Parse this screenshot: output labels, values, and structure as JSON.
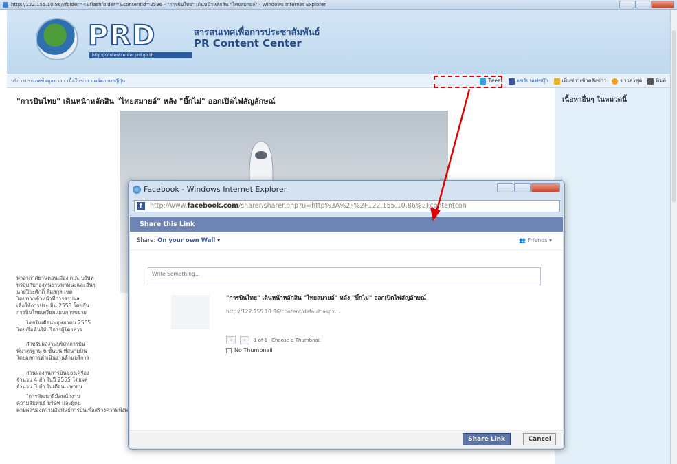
{
  "browser": {
    "title": "http://122.155.10.86/?folder=4&flashfolder=&contentid=2596 - \"การบินไทย\" เดินหน้าหลักสิน \"ไทยสมายล์\" - Windows Internet Explorer"
  },
  "site": {
    "logo_text": "PRD",
    "logo_url": "http://contentcenter.prd.go.th",
    "name_th": "สารสนเทศเพื่อการประชาสัมพันธ์",
    "name_en": "PR Content Center"
  },
  "nav": {
    "breadcrumb": "บริการประเภทข้อมูลข่าว › เนื้อในข่าว › ผลิตภาษาญี่ปุ่น",
    "actions": [
      {
        "label": "Tweet",
        "icon": "twitter-icon",
        "color": "#3aa0e0"
      },
      {
        "label": "แชร์บนเฟซบุ๊ก",
        "icon": "facebook-icon",
        "color": "#3b5998"
      },
      {
        "label": "เพิ่มข่าวเข้าคลังข่าว",
        "icon": "folder-icon",
        "color": "#e3b12c"
      },
      {
        "label": "ข่าวล่าสุด",
        "icon": "star-icon",
        "color": "#f0a020"
      },
      {
        "label": "พิมพ์",
        "icon": "printer-icon",
        "color": "#555555"
      }
    ]
  },
  "article": {
    "title": "\"การบินไทย\" เดินหน้าหลักสิน \"ไทยสมายล์\" หลัง \"บี๊กไม่\" ออกเปิดไฟสัญลักษณ์",
    "paragraphs": [
      [
        "ท่าอากาศยานดอนเมือง ก.ล. บริษัท",
        "พร้อมกับกองทุนยานพาหนะและอื่นๆ",
        "นายปิยะศักดิ์ ลิ่มสกุล เขต",
        "โดยทางเจ้าหน้าที่การสรุปผล",
        "เพื่อให้การประเมิน 2555 โดยกัน",
        "การบินไทยเตรียมแผนการขยาย"
      ],
      [
        "โดยในเดือนพฤษภาคม 2555",
        "โดยเริ่มต้นให้บริการผู้โดยสาร"
      ],
      [
        "สำหรับผลงานบริษัทการบิน",
        "ที่มาตรฐาน 6 ชั้นบน ที่สนามบิน",
        "โดยผลการดำเนินงานด้านบริการ"
      ],
      [
        "ส่วนผลงานการบินของเครื่อง",
        "จำนวน 4 ลำ ในปี 2555 โดยผล",
        "จำนวน 3 ลำ ในเดือนเมษายน"
      ],
      [
        "\"การพัฒนาฝีมือพนักงาน",
        "ความสัมพันธ์ บริษัท และผู้คน",
        "ตามผลของความสัมพันธ์การบินเพื่อสร้างความพึงพอใจต่อผู้โดยสาร"
      ]
    ]
  },
  "sidebar": {
    "title": "เนื้อหาอื่นๆ ในหมวดนี้"
  },
  "facebook_popup": {
    "window_title": "Facebook - Windows Internet Explorer",
    "address_prefix": "http://www.",
    "address_domain": "facebook.com",
    "address_rest": "/sharer/sharer.php?u=http%3A%2F%2F122.155.10.86%2Fcontentcon",
    "bar_label": "Share this Link",
    "share_label": "Share:",
    "share_target": "On your own Wall",
    "audience": "Friends",
    "textarea_placeholder": "Write Something...",
    "link_title": "\"การบินไทย\" เดินหน้าหลักสิน \"ไทยสมายล์\" หลัง \"บี๊กไม่\" ออกเปิดไฟสัญลักษณ์",
    "link_url": "http://122.155.10.86/content/default.aspx...",
    "pager_text": "1 of 1",
    "choose_thumb": "Choose a Thumbnail",
    "no_thumbnail": "No Thumbnail",
    "share_button": "Share Link",
    "cancel_button": "Cancel"
  },
  "annotation": {
    "highlight_color": "#e00000"
  }
}
